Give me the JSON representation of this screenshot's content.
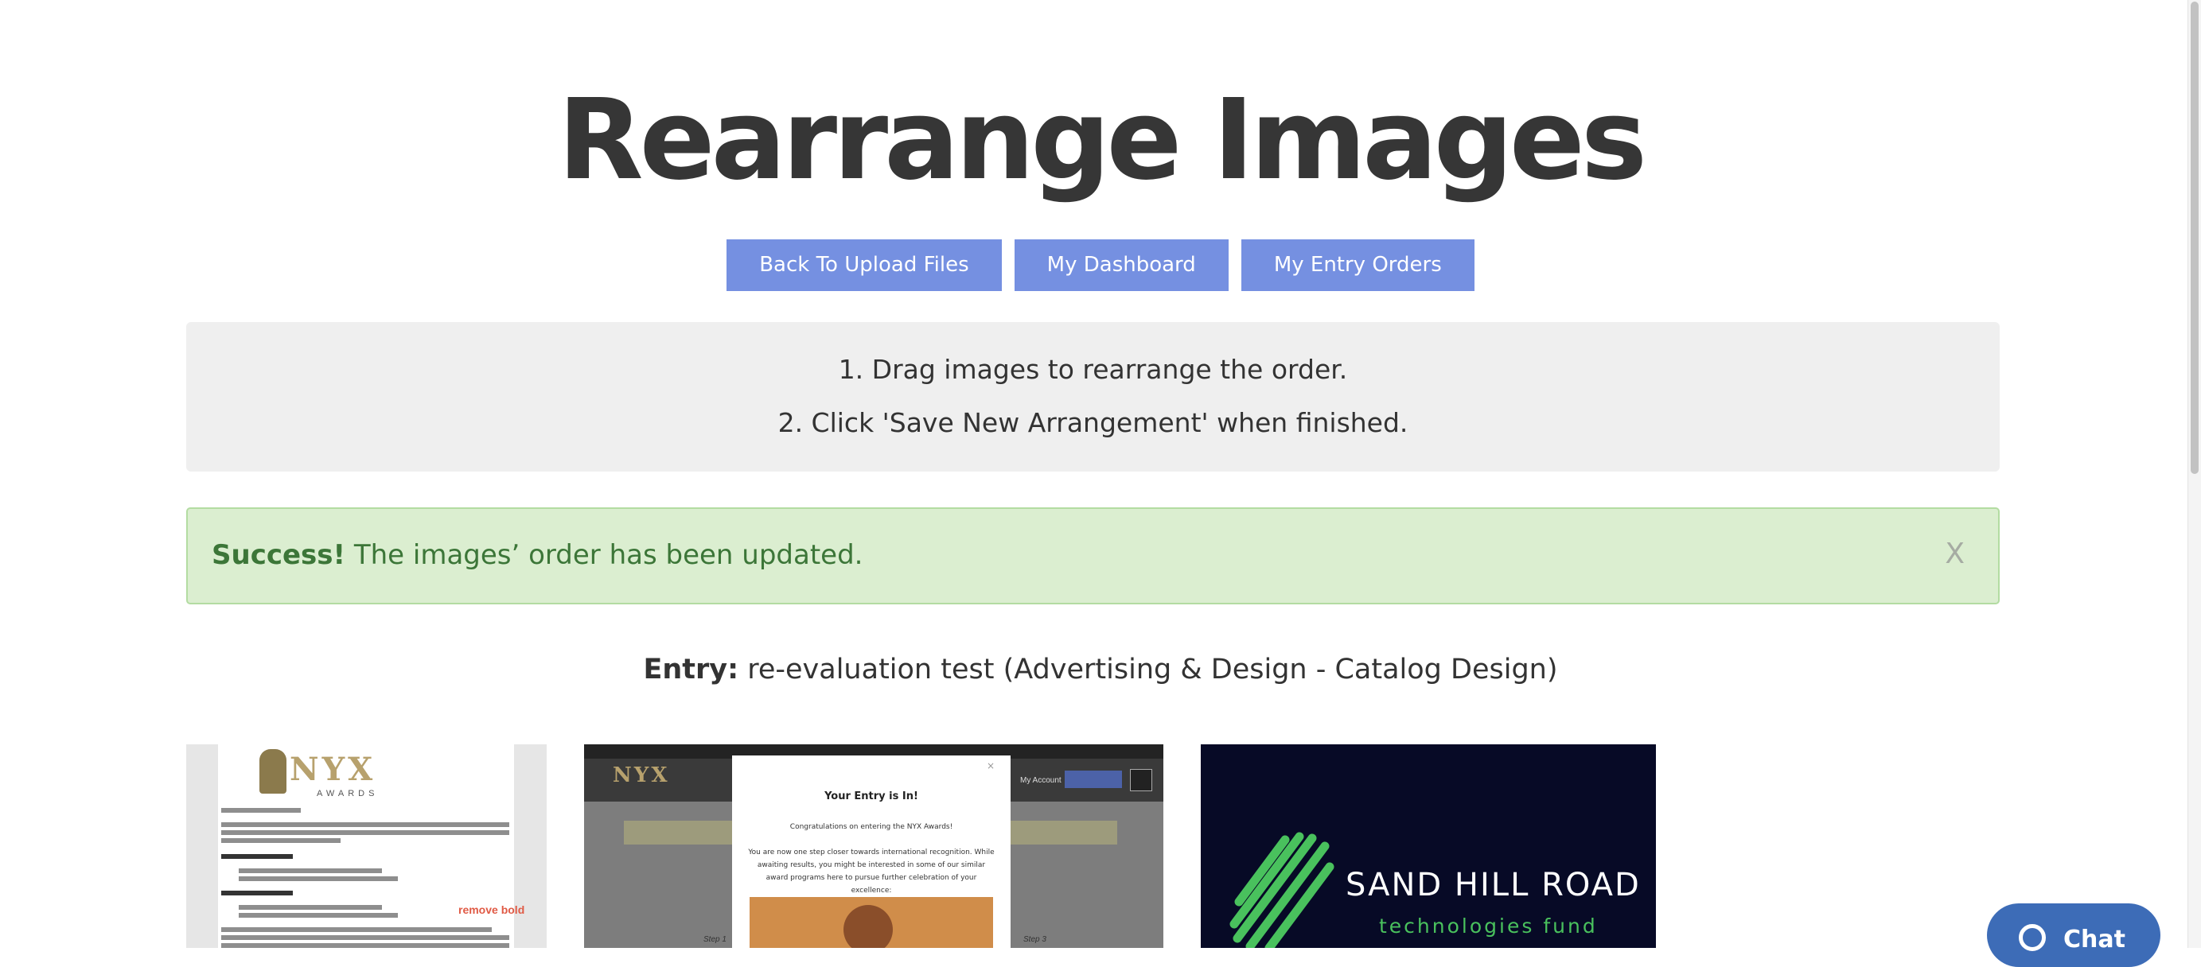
{
  "page": {
    "title": "Rearrange Images"
  },
  "nav": {
    "back_upload": "Back To Upload Files",
    "dashboard": "My Dashboard",
    "entry_orders": "My Entry Orders"
  },
  "instructions": {
    "step1": "1. Drag images to rearrange the order.",
    "step2": "2. Click 'Save New Arrangement' when finished."
  },
  "alert": {
    "strong": "Success!",
    "message": " The images’ order has been updated.",
    "close": "X"
  },
  "entry": {
    "label": "Entry:",
    "value": " re-evaluation test (Advertising & Design - Catalog Design)"
  },
  "images": {
    "image1": {
      "logo_text": "NYX",
      "logo_sub": "AWARDS",
      "annotation": "remove bold"
    },
    "image2": {
      "logo_text": "NYX",
      "account_text": "My Account",
      "modal_close": "×",
      "modal_title": "Your Entry is In!",
      "modal_line1": "Congratulations on entering the NYX Awards!",
      "modal_line2": "You are now one step closer towards international recognition. While awaiting results, you might be interested in some of our similar award programs here to pursue further celebration of your excellence:",
      "step_left": "Step 1",
      "step_right": "Step 3"
    },
    "image3": {
      "title": "SAND HILL ROAD",
      "subtitle": "technologies fund"
    }
  },
  "chat": {
    "label": "Chat"
  },
  "colors": {
    "nav_button": "#7590e1",
    "alert_bg": "#dbeed0",
    "alert_text": "#3c7638",
    "chat_button": "#3d6cb7",
    "brand_green": "#49c15d"
  }
}
